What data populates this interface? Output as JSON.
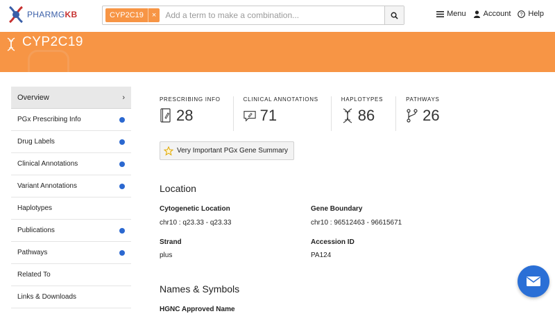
{
  "header": {
    "logo_text_a": "PHARMG",
    "logo_text_b": "KB",
    "search": {
      "chip_label": "CYP2C19",
      "chip_remove": "×",
      "placeholder": "Add a term to make a combination...",
      "value": ""
    },
    "nav": {
      "menu": "Menu",
      "account": "Account",
      "help": "Help"
    }
  },
  "banner": {
    "title": "CYP2C19",
    "color": "#f79545"
  },
  "sidebar": {
    "items": [
      {
        "label": "Overview",
        "active": true,
        "dot": false,
        "chevron": "›"
      },
      {
        "label": "PGx Prescribing Info",
        "dot": true
      },
      {
        "label": "Drug Labels",
        "dot": true
      },
      {
        "label": "Clinical Annotations",
        "dot": true
      },
      {
        "label": "Variant Annotations",
        "dot": true
      },
      {
        "label": "Haplotypes",
        "dot": false
      },
      {
        "label": "Publications",
        "dot": true
      },
      {
        "label": "Pathways",
        "dot": true
      },
      {
        "label": "Related To",
        "dot": false
      },
      {
        "label": "Links & Downloads",
        "dot": false
      }
    ],
    "dot_color": "#2b68d0"
  },
  "stats": [
    {
      "label": "Prescribing Info",
      "value": "28",
      "icon": "prescribing-icon"
    },
    {
      "label": "Clinical Annotations",
      "value": "71",
      "icon": "annotation-icon"
    },
    {
      "label": "Haplotypes",
      "value": "86",
      "icon": "dna-icon"
    },
    {
      "label": "Pathways",
      "value": "26",
      "icon": "pathway-icon"
    }
  ],
  "vip_button": "Very Important PGx Gene Summary",
  "location": {
    "title": "Location",
    "cytogenetic_label": "Cytogenetic Location",
    "cytogenetic_value": "chr10 : q23.33 - q23.33",
    "gene_boundary_label": "Gene Boundary",
    "gene_boundary_value": "chr10 : 96512463 - 96615671",
    "strand_label": "Strand",
    "strand_value": "plus",
    "accession_label": "Accession ID",
    "accession_value": "PA124"
  },
  "names": {
    "title": "Names & Symbols",
    "hgnc_label": "HGNC Approved Name"
  }
}
